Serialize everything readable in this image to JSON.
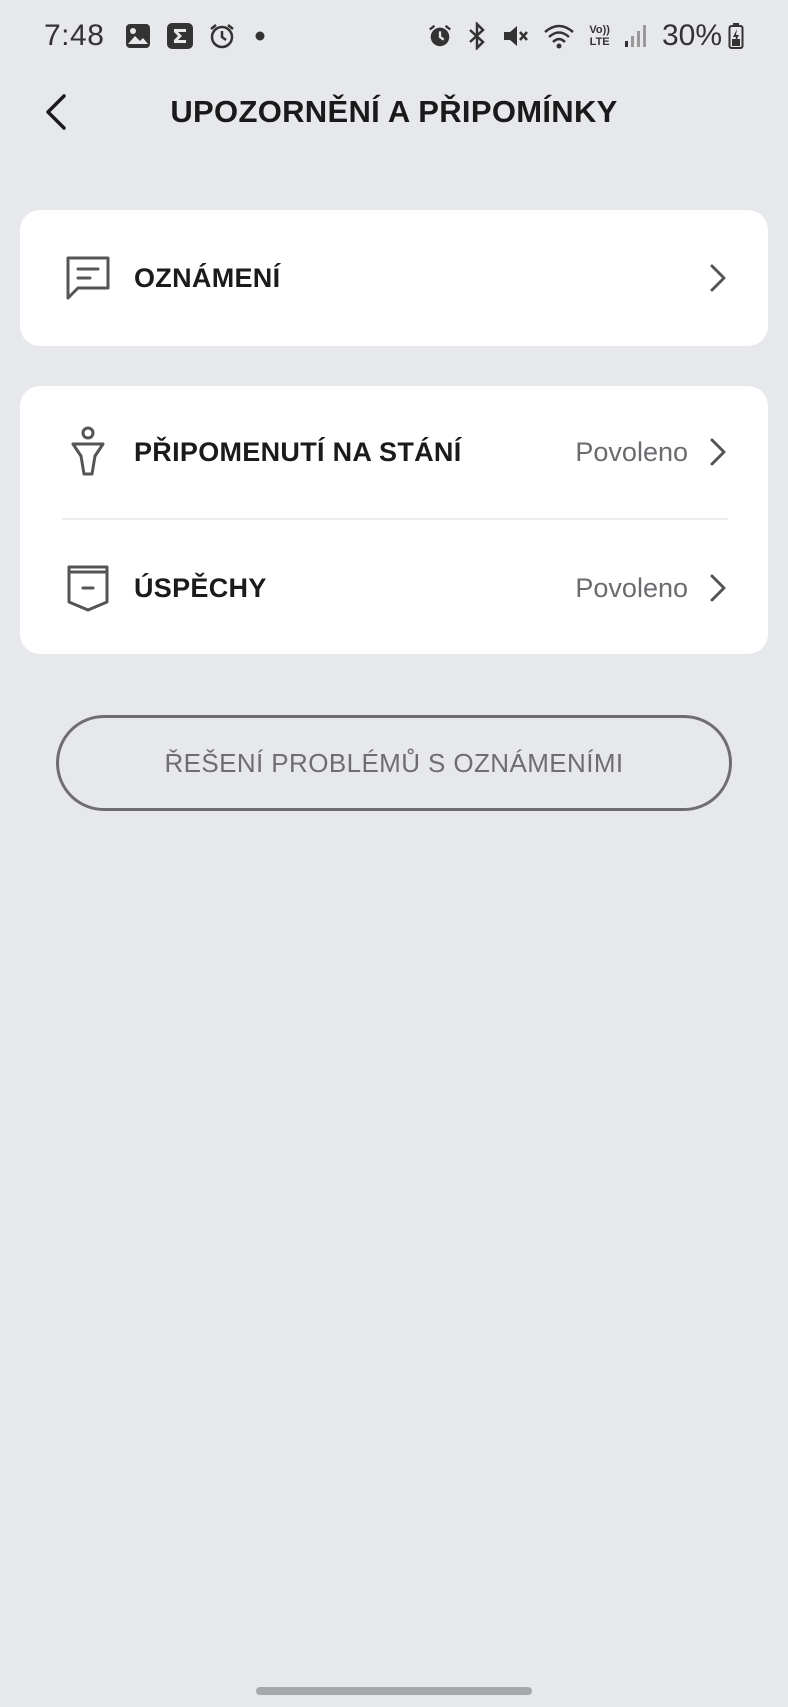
{
  "status_bar": {
    "time": "7:48",
    "battery": "30%",
    "left_icons": [
      "gallery-icon",
      "sigma-app-icon",
      "alarm-icon",
      "dot-icon"
    ],
    "right_icons": [
      "alarm-icon",
      "bluetooth-icon",
      "mute-icon",
      "wifi-icon",
      "volte-icon",
      "signal-icon",
      "battery-icon"
    ],
    "volte_line1": "Vo))",
    "volte_line2": "LTE"
  },
  "header": {
    "title": "UPOZORNĚNÍ A PŘIPOMÍNKY"
  },
  "settings": {
    "notifications": {
      "label": "OZNÁMENÍ",
      "icon": "message-icon"
    },
    "standing_reminder": {
      "label": "PŘIPOMENUTÍ NA STÁNÍ",
      "value": "Povoleno",
      "icon": "standing-person-icon"
    },
    "achievements": {
      "label": "ÚSPĚCHY",
      "value": "Povoleno",
      "icon": "badge-icon"
    }
  },
  "troubleshoot": {
    "label": "ŘEŠENÍ PROBLÉMŮ S OZNÁMENÍMI"
  },
  "colors": {
    "background": "#e7e8ec",
    "card": "#ffffff",
    "text_primary": "#1b1b1d",
    "text_secondary": "#6b6b70",
    "button_outline": "#6e6e72"
  }
}
